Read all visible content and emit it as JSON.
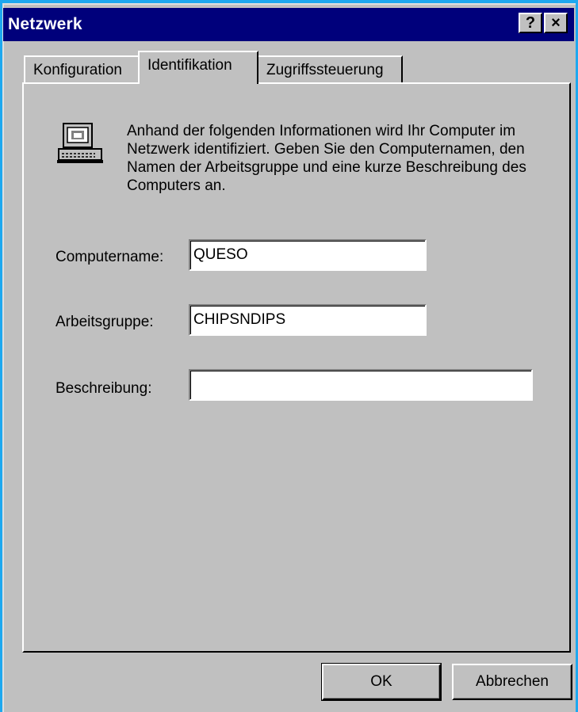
{
  "window": {
    "title": "Netzwerk",
    "help_label": "?",
    "close_label": "×"
  },
  "tabs": [
    {
      "label": "Konfiguration",
      "active": false
    },
    {
      "label": "Identifikation",
      "active": true
    },
    {
      "label": "Zugriffssteuerung",
      "active": false
    }
  ],
  "identification": {
    "description": "Anhand der folgenden Informationen wird Ihr Computer im Netzwerk identifiziert. Geben Sie den Computernamen, den Namen der Arbeitsgruppe und eine kurze Beschreibung des Computers an.",
    "icon": "computer-icon",
    "computername_label": "Computername:",
    "computername_value": "QUESO",
    "workgroup_label": "Arbeitsgruppe:",
    "workgroup_value": "CHIPSNDIPS",
    "description_label": "Beschreibung:",
    "description_value": ""
  },
  "buttons": {
    "ok_label": "OK",
    "cancel_label": "Abbrechen"
  },
  "colors": {
    "titlebar": "#00007b",
    "desktop": "#1ea8ef",
    "face": "#c0c0c0"
  }
}
